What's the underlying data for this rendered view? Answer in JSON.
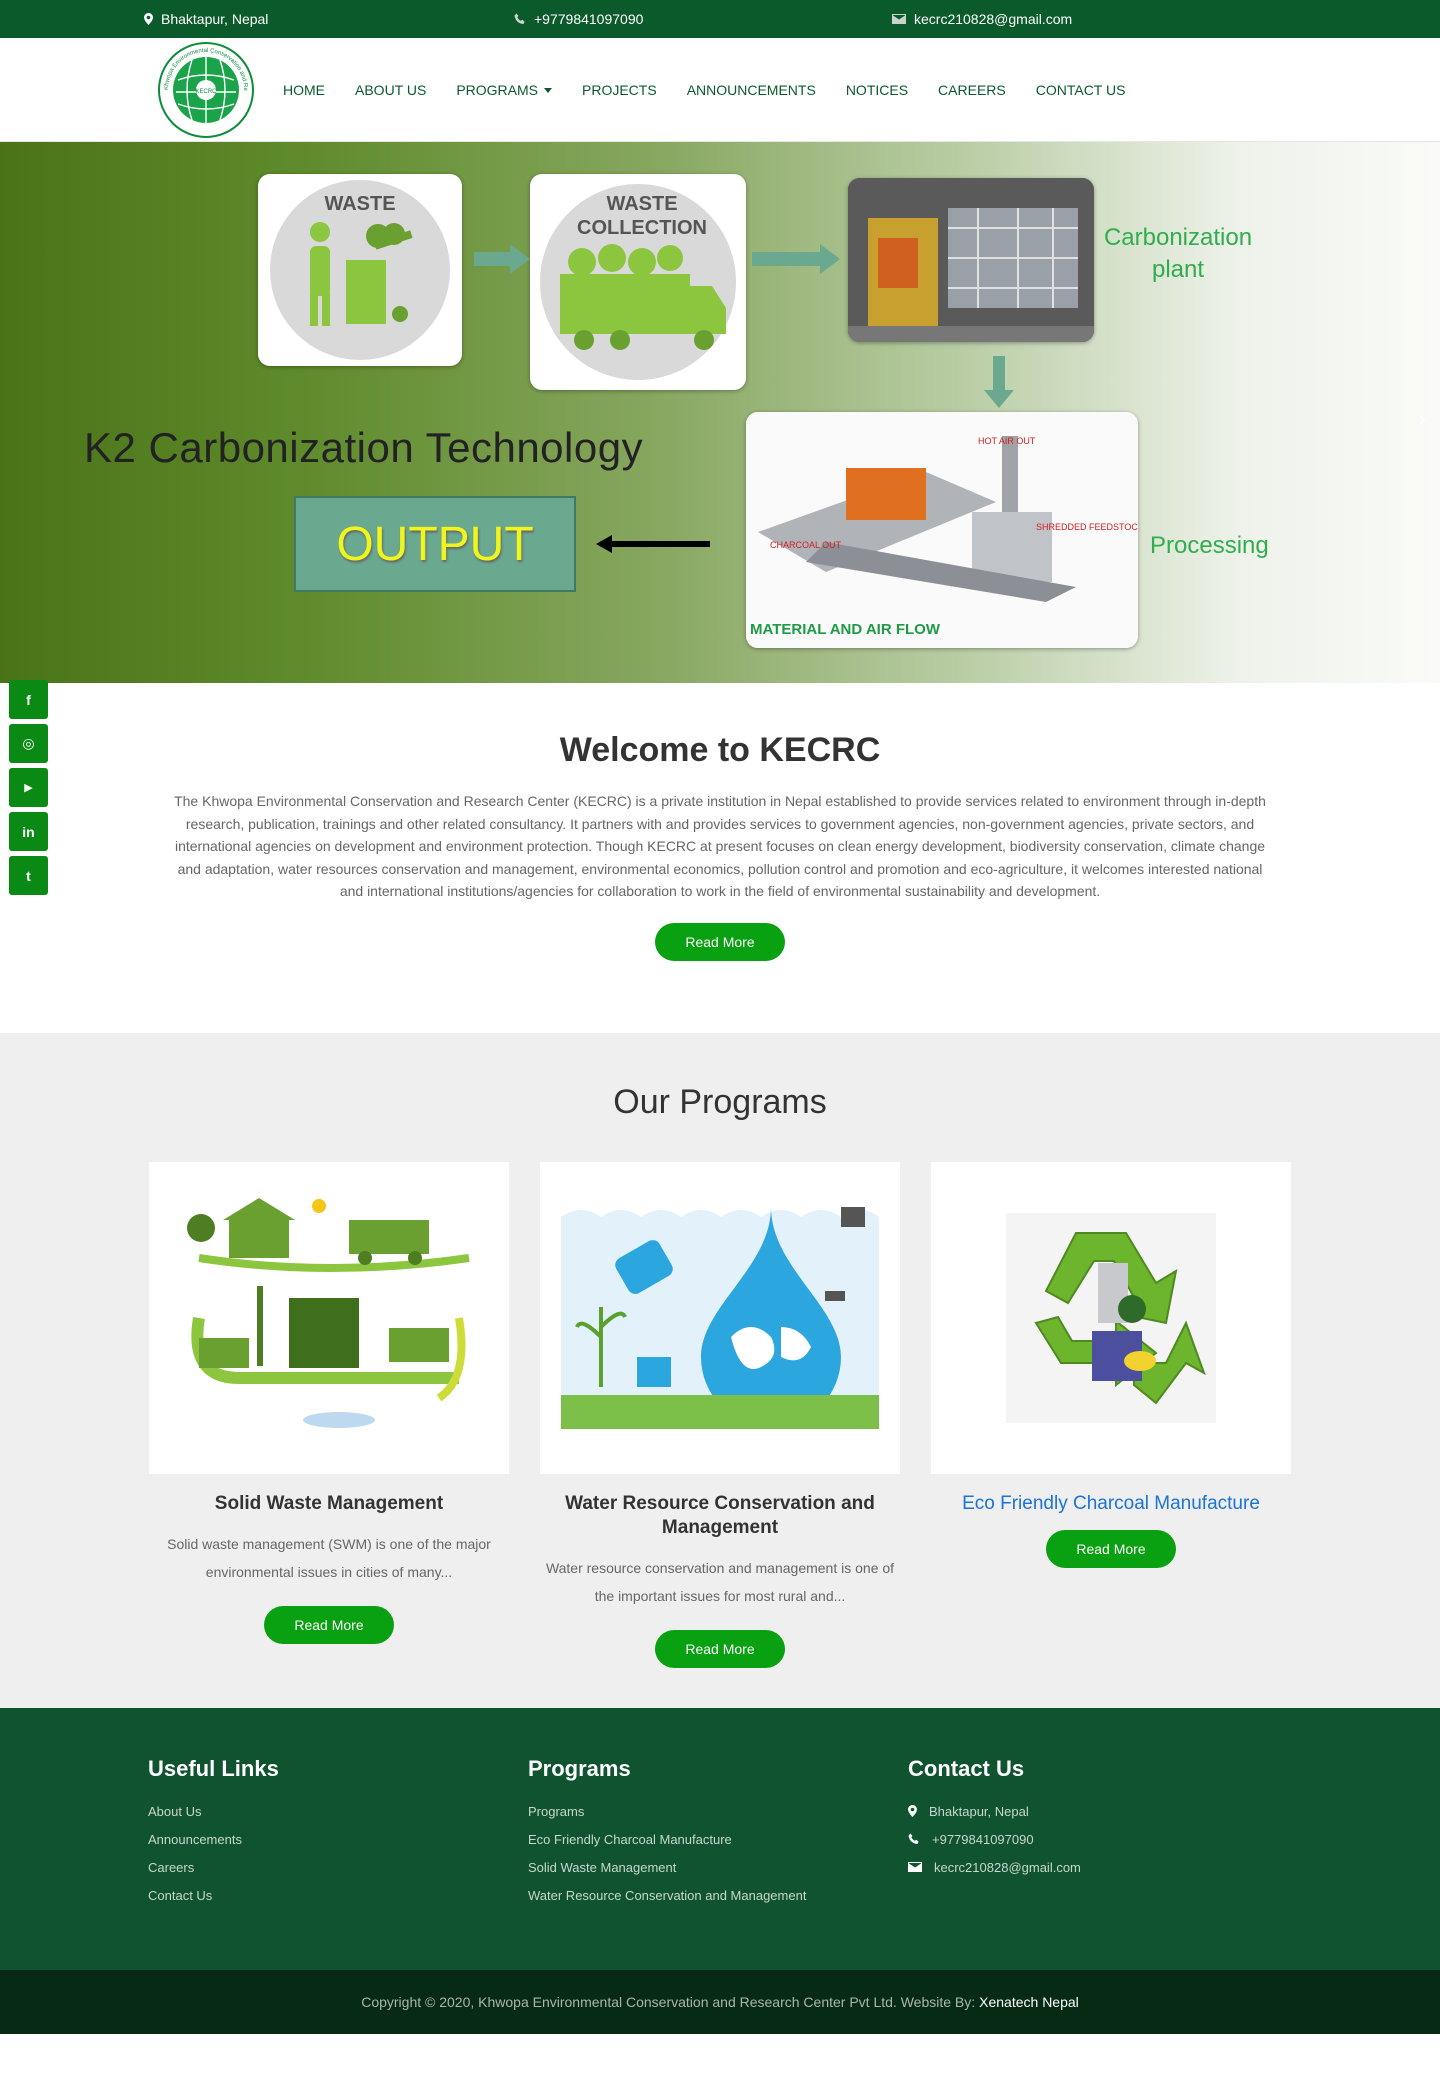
{
  "topbar": {
    "address": "Bhaktapur, Nepal",
    "phone": "+9779841097090",
    "email": "kecrc210828@gmail.com"
  },
  "nav": {
    "items": [
      "HOME",
      "ABOUT US",
      "PROGRAMS",
      "PROJECTS",
      "ANNOUNCEMENTS",
      "NOTICES",
      "CAREERS",
      "CONTACT US"
    ]
  },
  "hero": {
    "card1": "WASTE",
    "card2_line1": "WASTE",
    "card2_line2": "COLLECTION",
    "carbonization_line1": "Carbonization",
    "carbonization_line2": "plant",
    "title": "K2 Carbonization Technology",
    "output": "OUTPUT",
    "processing": "Processing",
    "hot_air": "HOT AIR OUT",
    "shredded": "SHREDDED FEEDSTOCK",
    "charcoal": "CHARCOAL OUT",
    "flow": "MATERIAL AND AIR FLOW"
  },
  "social": [
    "f",
    "◎",
    "▶",
    "in",
    "t"
  ],
  "welcome": {
    "title": "Welcome to KECRC",
    "text": "The Khwopa Environmental Conservation and Research Center (KECRC) is a private institution in Nepal established to provide services related to environment through in-depth research, publication, trainings and other related consultancy. It partners with and provides services to government agencies, non-government agencies, private sectors, and international agencies on development and environment protection. Though KECRC at present focuses on clean energy development, biodiversity conservation, climate change and adaptation, water resources conservation and management, environmental economics, pollution control and promotion and eco-agriculture, it welcomes interested national and international institutions/agencies for collaboration to work in the field of environmental sustainability and development.",
    "button": "Read More"
  },
  "programs": {
    "title": "Our Programs",
    "cards": [
      {
        "title": "Solid Waste Management",
        "text": "Solid waste management (SWM) is one of the major environmental issues in cities of many...",
        "button": "Read More"
      },
      {
        "title": "Water Resource Conservation and Management",
        "text": "Water resource conservation and management is one of the important issues for most rural and...",
        "button": "Read More"
      },
      {
        "title": "Eco Friendly Charcoal Manufacture",
        "text": "",
        "button": "Read More"
      }
    ]
  },
  "footer": {
    "useful_title": "Useful Links",
    "useful": [
      "About Us",
      "Announcements",
      "Careers",
      "Contact Us"
    ],
    "programs_title": "Programs",
    "programs": [
      "Programs",
      "Eco Friendly Charcoal Manufacture",
      "Solid Waste Management",
      "Water Resource Conservation and Management"
    ],
    "contact_title": "Contact Us",
    "contact_address": "Bhaktapur, Nepal",
    "contact_phone": "+9779841097090",
    "contact_email": "kecrc210828@gmail.com",
    "copyright": "Copyright © 2020, Khwopa Environmental Conservation and Research Center Pvt Ltd. Website By:",
    "brand": "Xenatech Nepal"
  },
  "logo": {
    "text": "Khwopa Environmental Conservation and Research Center Pvt. Ltd.",
    "abbr": "KECRC"
  }
}
